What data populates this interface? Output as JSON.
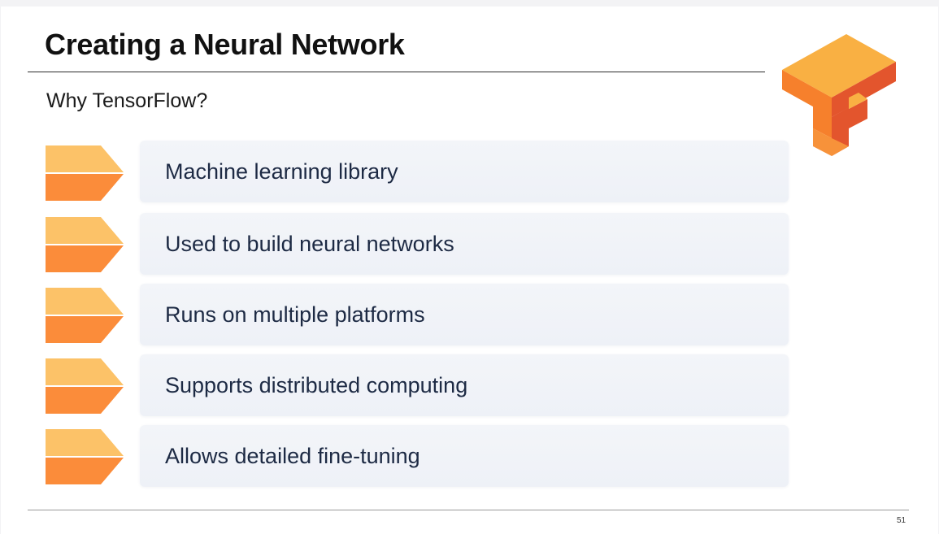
{
  "slide": {
    "title": "Creating a Neural Network",
    "subtitle": "Why TensorFlow?",
    "page_number": "51",
    "logo_icon": "tensorflow-logo-icon",
    "bullet_icon": "chevron-arrow-icon",
    "items": [
      {
        "label": "Machine learning library"
      },
      {
        "label": "Used to build neural networks"
      },
      {
        "label": "Runs on multiple platforms"
      },
      {
        "label": "Supports distributed computing"
      },
      {
        "label": "Allows detailed fine-tuning"
      }
    ]
  },
  "colors": {
    "bullet_top": "#fcc268",
    "bullet_bottom": "#fb8c3a",
    "logo_top": "#f9b043",
    "logo_left": "#f6802c",
    "logo_right": "#e3552d",
    "card_background": "#f0f3f8",
    "card_text": "#1d2a44"
  }
}
